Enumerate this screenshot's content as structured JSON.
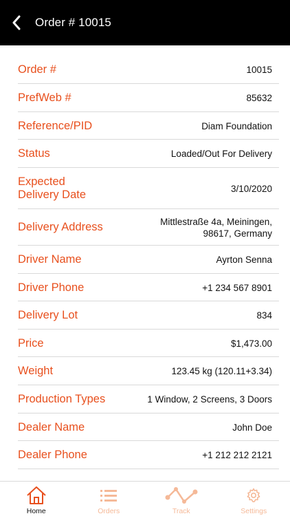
{
  "header": {
    "title": "Order # 10015"
  },
  "details": [
    {
      "label": "Order #",
      "value": "10015"
    },
    {
      "label": "PrefWeb #",
      "value": "85632"
    },
    {
      "label": "Reference/PID",
      "value": "Diam Foundation"
    },
    {
      "label": "Status",
      "value": "Loaded/Out For Delivery"
    },
    {
      "label": "Expected Delivery Date",
      "value": "3/10/2020"
    },
    {
      "label": "Delivery Address",
      "value": "Mittlestraße 4a, Meiningen, 98617, Germany"
    },
    {
      "label": "Driver Name",
      "value": "Ayrton Senna"
    },
    {
      "label": "Driver Phone",
      "value": "+1 234 567 8901"
    },
    {
      "label": "Delivery Lot",
      "value": "834"
    },
    {
      "label": "Price",
      "value": "$1,473.00"
    },
    {
      "label": "Weight",
      "value": "123.45 kg (120.11+3.34)"
    },
    {
      "label": "Production Types",
      "value": "1 Window, 2 Screens, 3 Doors"
    },
    {
      "label": "Dealer Name",
      "value": "John Doe"
    },
    {
      "label": "Dealer Phone",
      "value": "+1 212 212 2121"
    }
  ],
  "tabbar": {
    "tabs": [
      {
        "label": "Home",
        "icon": "home-icon",
        "active": true
      },
      {
        "label": "Orders",
        "icon": "list-icon",
        "active": false
      },
      {
        "label": "Track",
        "icon": "track-icon",
        "active": false
      },
      {
        "label": "Settings",
        "icon": "gear-icon",
        "active": false
      }
    ]
  },
  "colors": {
    "accent": "#e8501e",
    "accent_light": "#f5b998",
    "header_bg": "#000000",
    "divider": "#d9d9d9"
  }
}
